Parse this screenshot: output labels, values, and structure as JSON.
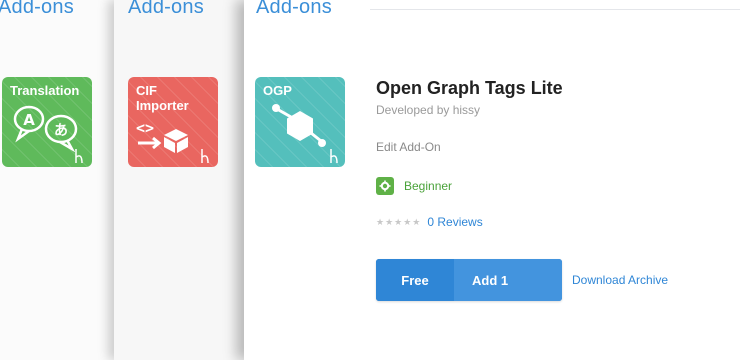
{
  "panels": [
    {
      "title": "Add-ons",
      "tile_label": "Translation"
    },
    {
      "title": "Add-ons",
      "tile_label_line1": "CIF",
      "tile_label_line2": "Importer"
    },
    {
      "title": "Add-ons",
      "tile_label": "OGP"
    }
  ],
  "addon": {
    "title": "Open Graph Tags Lite",
    "developer": "Developed by hissy",
    "edit_link": "Edit Add-On",
    "level": "Beginner",
    "stars": "★★★★★",
    "reviews": "0 Reviews",
    "price": "Free",
    "add_label": "Add 1",
    "download": "Download Archive"
  },
  "colors": {
    "accent": "#2f86d6",
    "translation_tile": "#5fba5b",
    "cif_tile": "#e96660",
    "ogp_tile": "#54bfbc",
    "level_green": "#5fb147"
  }
}
